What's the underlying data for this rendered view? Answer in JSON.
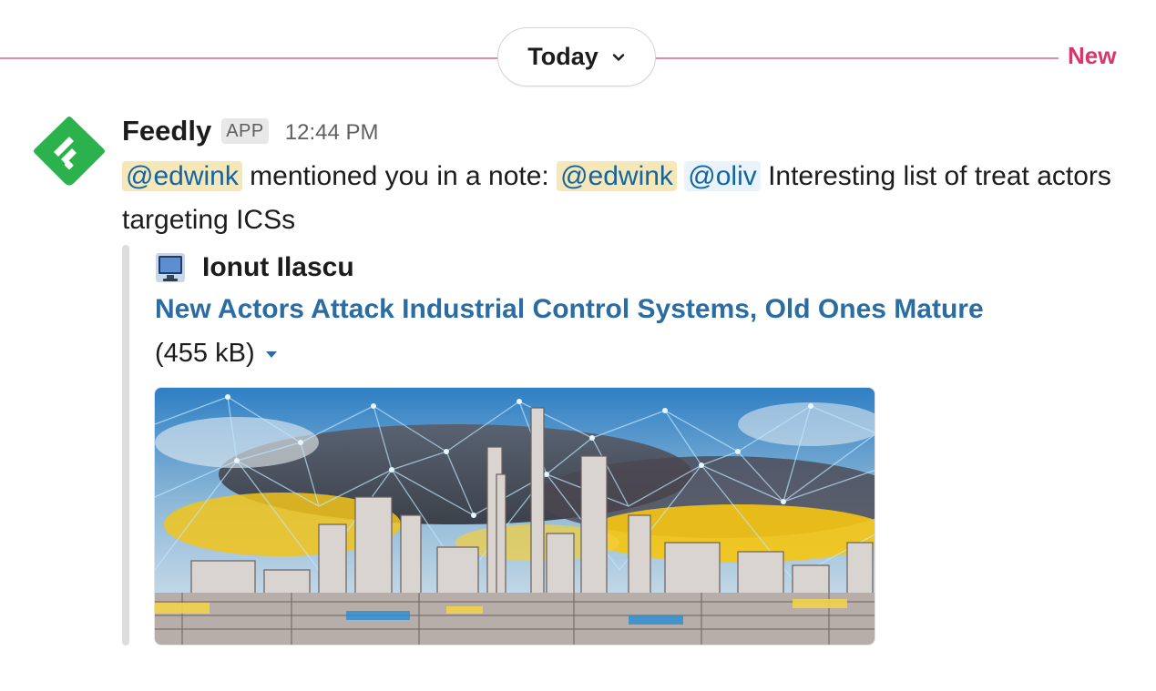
{
  "divider": {
    "date_label": "Today",
    "new_label": "New"
  },
  "message": {
    "sender": "Feedly",
    "badge": "APP",
    "timestamp": "12:44 PM",
    "mention_1": "@edwink",
    "text_1": " mentioned you in a note: ",
    "mention_2": "@edwink",
    "mention_3": "@oliv",
    "text_2": " Interesting list of treat actors targeting ICSs"
  },
  "attachment": {
    "author": "Ionut Ilascu",
    "title": "New Actors Attack Industrial Control Systems, Old Ones Mature",
    "file_size": "(455 kB)"
  },
  "icons": {
    "app": "feedly-logo-icon",
    "author": "computer-monitor-icon",
    "date_dropdown": "chevron-down-icon",
    "size_toggle": "caret-down-icon"
  },
  "colors": {
    "new_divider": "#d4386d",
    "link": "#2b6ca3",
    "mention_self_bg": "#f6e7b9",
    "mention_other_bg": "#e8f3fb",
    "feedly_green": "#2bb24c"
  }
}
